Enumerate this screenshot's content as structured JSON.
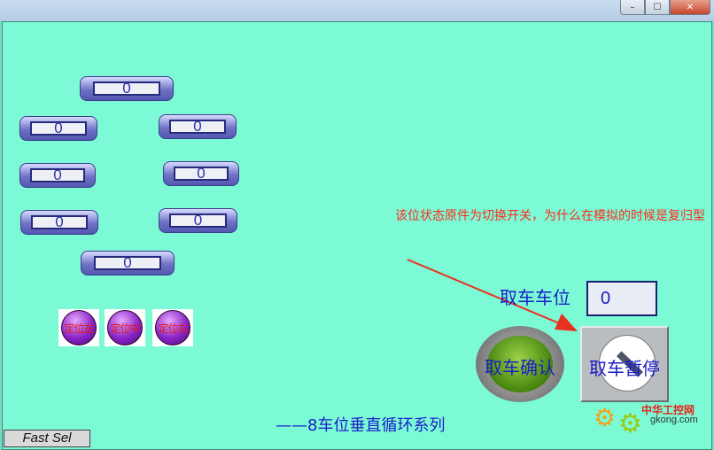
{
  "window": {
    "title": "",
    "minimize_icon": "–",
    "maximize_icon": "☐",
    "close_icon": "✕"
  },
  "slots": [
    "0",
    "0",
    "0",
    "0",
    "0",
    "0",
    "0",
    "0"
  ],
  "lamps": [
    "定位左",
    "定位中",
    "定位右"
  ],
  "note": "该位状态原件为切换开关，为什么在模拟的时候是复归型",
  "pick": {
    "label": "取车车位",
    "value": "0"
  },
  "confirm_button": "取车确认",
  "pause_switch": "取车暂停",
  "series_title": "——8车位垂直循环系列",
  "fast_sel": "Fast Sel",
  "watermark": {
    "text": "中华工控网",
    "url": "gkong.com",
    "gear_icon": "⚙"
  },
  "colors": {
    "background": "#7cfad6",
    "text_blue": "#1c1cc8",
    "note_red": "#ff2a1a"
  }
}
